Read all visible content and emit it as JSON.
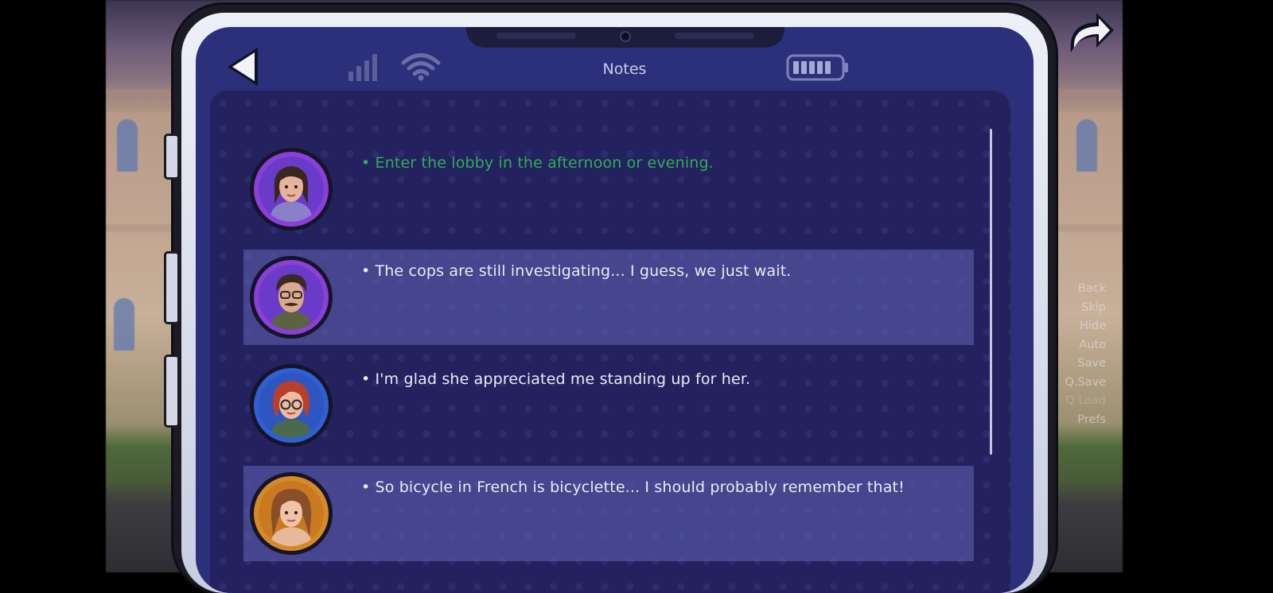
{
  "phone": {
    "title": "Notes",
    "notes": [
      {
        "text": "• Enter the lobby in the afternoon or evening.",
        "status": "completed",
        "avatar": "dark-haired-woman"
      },
      {
        "text": "• The cops are still investigating... I guess, we just wait.",
        "status": "active",
        "avatar": "man-with-mustache-and-glasses"
      },
      {
        "text": "• I'm glad she appreciated me standing up for her.",
        "status": "active",
        "avatar": "red-haired-woman-with-glasses"
      },
      {
        "text": "• So bicycle in French is bicyclette... I should probably remember that!",
        "status": "active",
        "avatar": "brown-haired-woman"
      }
    ]
  },
  "quick_menu": {
    "back": "Back",
    "skip": "Skip",
    "hide": "Hide",
    "auto": "Auto",
    "save": "Save",
    "qsave": "Q.Save",
    "qload": "Q.Load",
    "prefs": "Prefs"
  },
  "colors": {
    "screen": "#2c2f7a",
    "completed_note": "#2fae56",
    "note_text": "#eceaf6"
  }
}
